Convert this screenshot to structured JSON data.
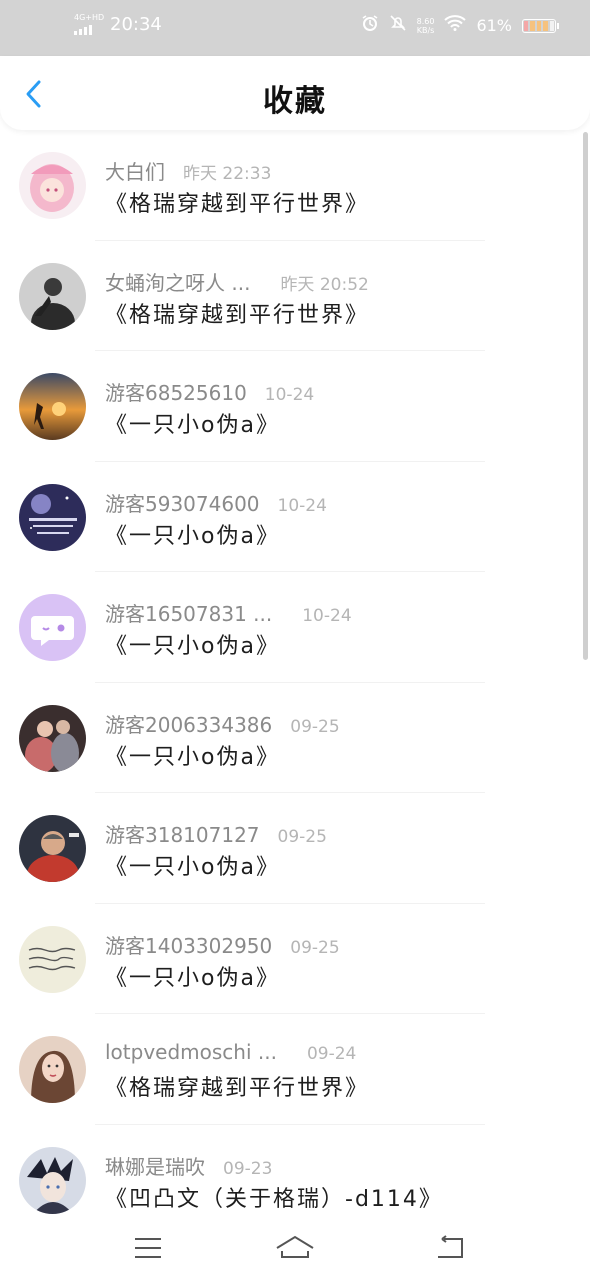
{
  "status_bar": {
    "network": "4G+HD",
    "time": "20:34",
    "speed_value": "8.60",
    "speed_unit": "KB/s",
    "battery": "61%",
    "icons": [
      "signal-icon",
      "alarm-icon",
      "silent-icon",
      "wifi-icon",
      "battery-icon"
    ]
  },
  "header": {
    "title": "收藏",
    "back_icon": "chevron-left-icon",
    "accent": "#2a9df4"
  },
  "favorites": [
    {
      "author": "大白们",
      "time": "昨天 22:33",
      "book": "《格瑞穿越到平行世界》",
      "avatar": "avatar-pink-hair"
    },
    {
      "author": "女蛹洵之呀人 ...",
      "time": "昨天 20:52",
      "book": "《格瑞穿越到平行世界》",
      "avatar": "avatar-dark-figure"
    },
    {
      "author": "游客68525610",
      "time": "10-24",
      "book": "《一只小o伪a》",
      "avatar": "avatar-sunset"
    },
    {
      "author": "游客593074600",
      "time": "10-24",
      "book": "《一只小o伪a》",
      "avatar": "avatar-galaxy"
    },
    {
      "author": "游客16507831 ...",
      "time": "10-24",
      "book": "《一只小o伪a》",
      "avatar": "avatar-default-purple"
    },
    {
      "author": "游客2006334386",
      "time": "09-25",
      "book": "《一只小o伪a》",
      "avatar": "avatar-couple"
    },
    {
      "author": "游客318107127",
      "time": "09-25",
      "book": "《一只小o伪a》",
      "avatar": "avatar-man-portrait"
    },
    {
      "author": "游客1403302950",
      "time": "09-25",
      "book": "《一只小o伪a》",
      "avatar": "avatar-handwriting"
    },
    {
      "author": "lotpvedmoschi ...",
      "time": "09-24",
      "book": "《格瑞穿越到平行世界》",
      "avatar": "avatar-woman"
    },
    {
      "author": "琳娜是瑞吹",
      "time": "09-23",
      "book": "《凹凸文（关于格瑞）-d114》",
      "avatar": "avatar-anime-dark"
    }
  ],
  "bottom_nav": {
    "icons": [
      "menu-icon",
      "home-icon",
      "back-icon"
    ]
  }
}
